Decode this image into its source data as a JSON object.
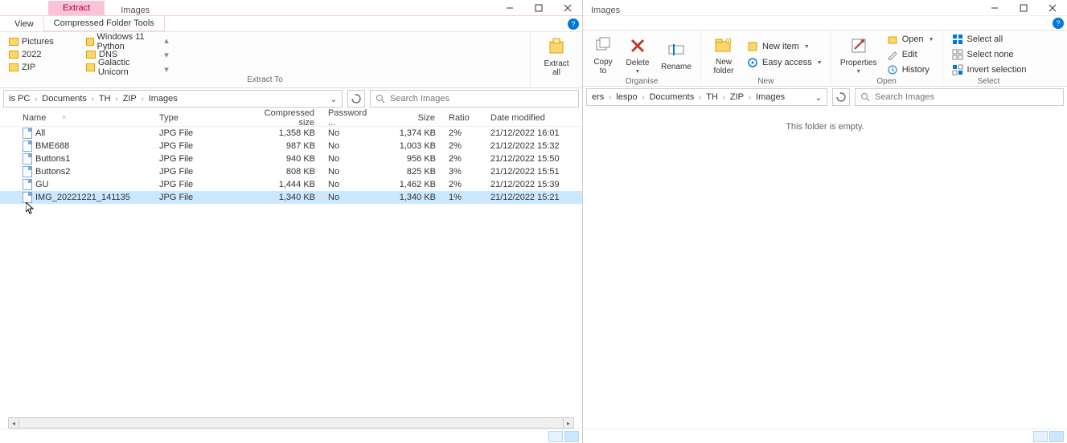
{
  "left_window": {
    "context_tab": "Extract",
    "title": "Images",
    "tabs": {
      "view": "View",
      "tools": "Compressed Folder Tools"
    },
    "extract_to_label": "Extract To",
    "destinations": [
      [
        "Pictures",
        "Windows 11 Python"
      ],
      [
        "2022",
        "DNS"
      ],
      [
        "ZIP",
        "Galactic Unicorn"
      ]
    ],
    "extract_all_btn": "Extract\nall",
    "breadcrumb": [
      "is PC",
      "Documents",
      "TH",
      "ZIP",
      "Images"
    ],
    "search_placeholder": "Search Images",
    "columns": {
      "name": "Name",
      "type": "Type",
      "compressed": "Compressed size",
      "password": "Password ...",
      "size": "Size",
      "ratio": "Ratio",
      "date": "Date modified"
    },
    "files": [
      {
        "name": "All",
        "type": "JPG File",
        "comp": "1,358 KB",
        "pass": "No",
        "size": "1,374 KB",
        "ratio": "2%",
        "date": "21/12/2022 16:01"
      },
      {
        "name": "BME688",
        "type": "JPG File",
        "comp": "987 KB",
        "pass": "No",
        "size": "1,003 KB",
        "ratio": "2%",
        "date": "21/12/2022 15:32"
      },
      {
        "name": "Buttons1",
        "type": "JPG File",
        "comp": "940 KB",
        "pass": "No",
        "size": "956 KB",
        "ratio": "2%",
        "date": "21/12/2022 15:50"
      },
      {
        "name": "Buttons2",
        "type": "JPG File",
        "comp": "808 KB",
        "pass": "No",
        "size": "825 KB",
        "ratio": "3%",
        "date": "21/12/2022 15:51"
      },
      {
        "name": "GU",
        "type": "JPG File",
        "comp": "1,444 KB",
        "pass": "No",
        "size": "1,462 KB",
        "ratio": "2%",
        "date": "21/12/2022 15:39"
      },
      {
        "name": "IMG_20221221_141135",
        "type": "JPG File",
        "comp": "1,340 KB",
        "pass": "No",
        "size": "1,340 KB",
        "ratio": "1%",
        "date": "21/12/2022 15:21"
      }
    ],
    "selected_index": 5
  },
  "right_window": {
    "title": "Images",
    "ribbon": {
      "organise": {
        "label": "Organise",
        "copy": "Copy\nto",
        "delete": "Delete",
        "rename": "Rename"
      },
      "new": {
        "label": "New",
        "new_folder": "New\nfolder",
        "new_item": "New item",
        "easy_access": "Easy access"
      },
      "open": {
        "label": "Open",
        "properties": "Properties",
        "open": "Open",
        "edit": "Edit",
        "history": "History"
      },
      "select": {
        "label": "Select",
        "select_all": "Select all",
        "select_none": "Select none",
        "invert": "Invert selection"
      }
    },
    "breadcrumb": [
      "ers",
      "lespo",
      "Documents",
      "TH",
      "ZIP",
      "Images"
    ],
    "search_placeholder": "Search Images",
    "empty": "This folder is empty."
  }
}
